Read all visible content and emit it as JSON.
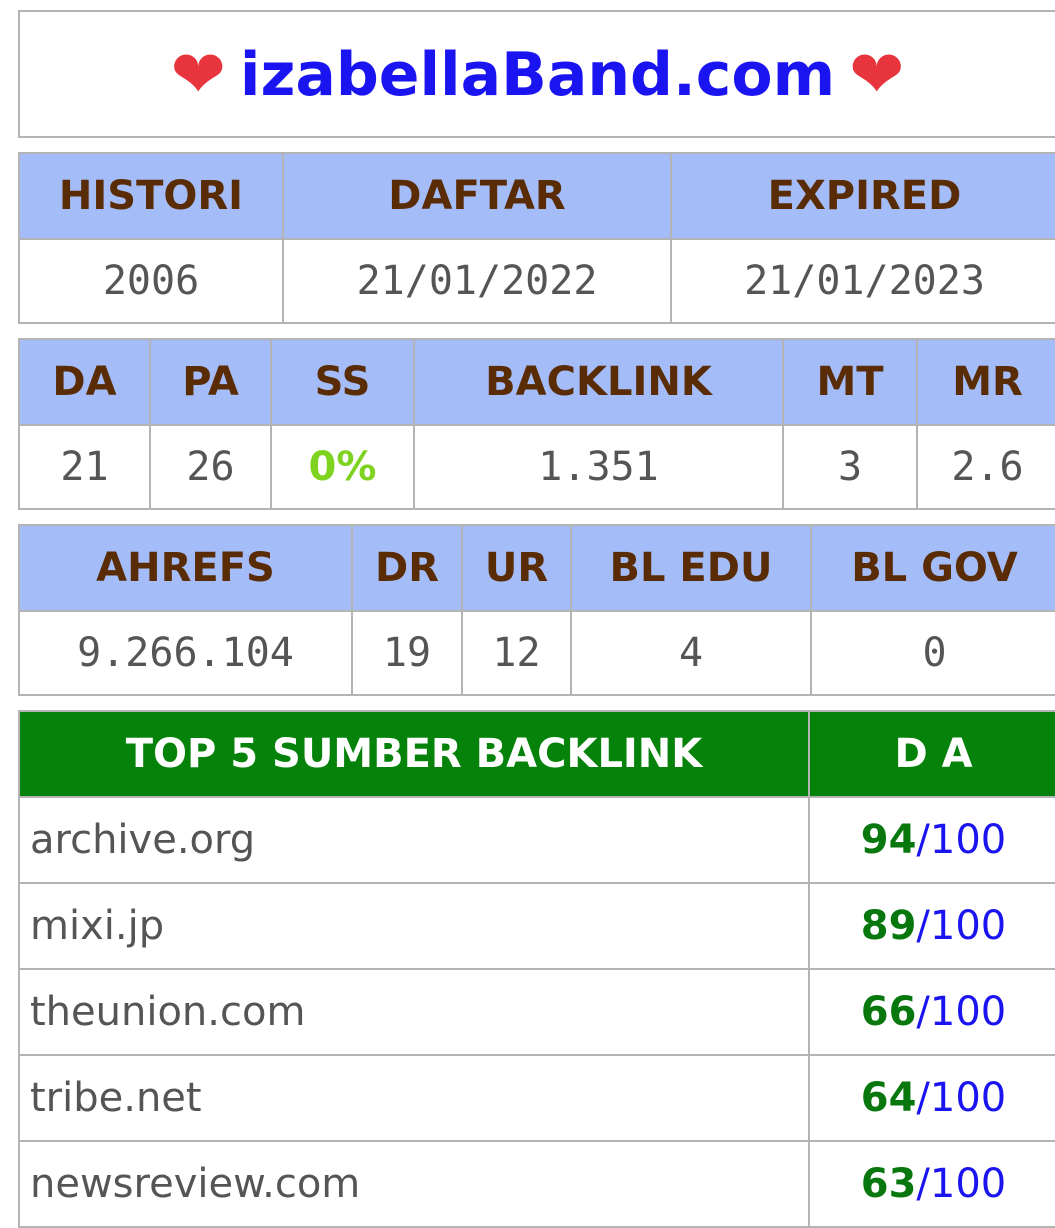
{
  "title": {
    "heart_left": "❤",
    "text": "izabellaBand.com",
    "heart_right": "❤"
  },
  "registration": {
    "headers": [
      "HISTORI",
      "DAFTAR",
      "EXPIRED"
    ],
    "values": [
      "2006",
      "21/01/2022",
      "21/01/2023"
    ]
  },
  "moz": {
    "headers": [
      "DA",
      "PA",
      "SS",
      "BACKLINK",
      "MT",
      "MR"
    ],
    "values": [
      "21",
      "26",
      "0%",
      "1.351",
      "3",
      "2.6"
    ]
  },
  "ahrefs": {
    "headers": [
      "AHREFS",
      "DR",
      "UR",
      "BL EDU",
      "BL GOV"
    ],
    "values": [
      "9.266.104",
      "19",
      "12",
      "4",
      "0"
    ]
  },
  "top_sources": {
    "header_source": "TOP 5 SUMBER BACKLINK",
    "header_da": "D A",
    "rows": [
      {
        "domain": "archive.org",
        "da": "94",
        "max": "100"
      },
      {
        "domain": "mixi.jp",
        "da": "89",
        "max": "100"
      },
      {
        "domain": "theunion.com",
        "da": "66",
        "max": "100"
      },
      {
        "domain": "tribe.net",
        "da": "64",
        "max": "100"
      },
      {
        "domain": "newsreview.com",
        "da": "63",
        "max": "100"
      }
    ],
    "separator": "/"
  },
  "colors": {
    "title": "#1a14f0",
    "heart": "#e8343c",
    "header_bg": "#a4bcf8",
    "header_text": "#5a2c06",
    "top_header_bg": "#05820a",
    "ss_value": "#7ed321",
    "da_value": "#08780e"
  }
}
